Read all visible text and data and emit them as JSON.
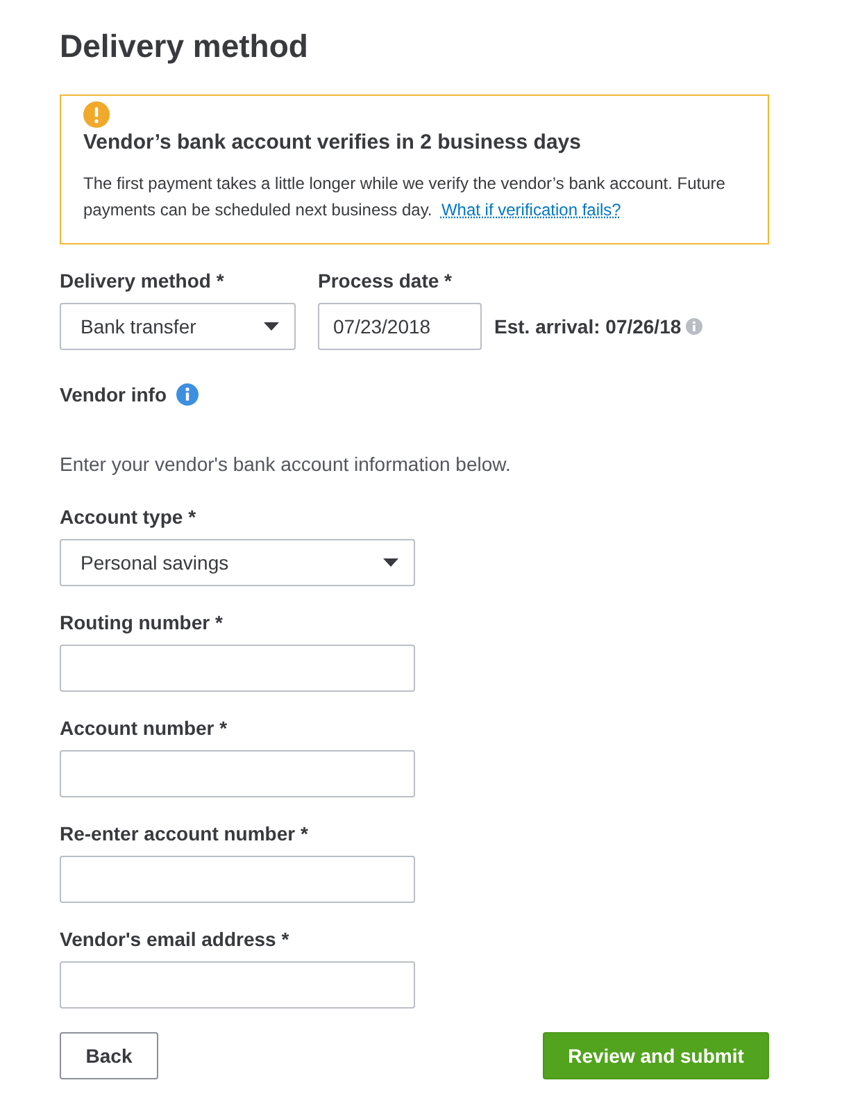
{
  "title": "Delivery method",
  "alert": {
    "heading": "Vendor’s bank account verifies in 2 business days",
    "body": "The first payment takes a little longer while we verify the vendor’s bank account. Future payments can be scheduled next business day.",
    "link": "What if verification fails?"
  },
  "delivery": {
    "fields": [
      {
        "kind": "select",
        "label": "Delivery method *",
        "value": "Bank transfer"
      },
      {
        "kind": "date",
        "label": "Process date *",
        "value": "07/23/2018"
      }
    ],
    "arrival": "Est. arrival: 07/26/18"
  },
  "vendor_info": {
    "heading": "Vendor info",
    "instructions": "Enter your vendor's bank account information below.",
    "fields": [
      {
        "kind": "select",
        "label": "Account type *",
        "value": "Personal savings"
      },
      {
        "kind": "text",
        "label": "Routing number *"
      },
      {
        "kind": "text",
        "label": "Account number *"
      },
      {
        "kind": "text",
        "label": "Re-enter account number *"
      },
      {
        "kind": "text",
        "label": "Vendor's email address *"
      }
    ]
  },
  "buttons": [
    {
      "kind": "secondary",
      "label": "Back"
    },
    {
      "kind": "primary",
      "label": "Review and submit"
    }
  ]
}
